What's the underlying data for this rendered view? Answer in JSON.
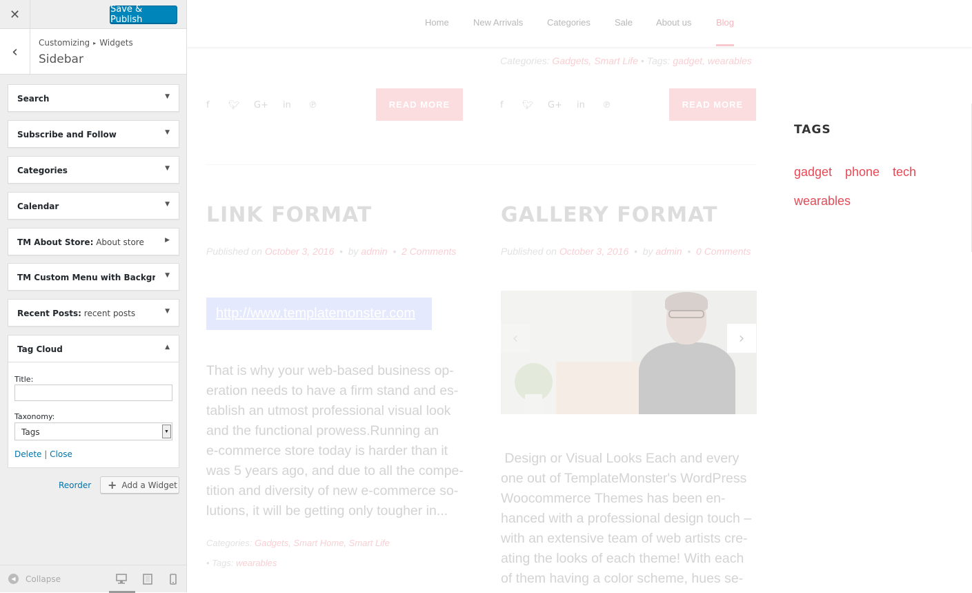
{
  "customizer": {
    "close_icon": "close-icon",
    "publish_label": "Save & Publish",
    "breadcrumb": [
      "Customizing",
      "Widgets"
    ],
    "section_title": "Sidebar",
    "widgets": [
      {
        "title": "Search",
        "subtitle": ""
      },
      {
        "title": "Subscribe and Follow",
        "subtitle": ""
      },
      {
        "title": "Categories",
        "subtitle": ""
      },
      {
        "title": "Calendar",
        "subtitle": ""
      },
      {
        "title": "TM About Store:",
        "subtitle": "About store"
      },
      {
        "title": "TM Custom Menu with Backgrou...",
        "subtitle": ""
      },
      {
        "title": "Recent Posts:",
        "subtitle": "recent posts"
      },
      {
        "title": "Tag Cloud",
        "subtitle": ""
      }
    ],
    "tag_cloud_form": {
      "title_label": "Title:",
      "title_value": "",
      "taxonomy_label": "Taxonomy:",
      "taxonomy_value": "Tags",
      "delete_label": "Delete",
      "separator": "|",
      "close_label": "Close"
    },
    "reorder_label": "Reorder",
    "add_widget_label": "Add a Widget",
    "collapse_label": "Collapse"
  },
  "preview": {
    "nav": [
      "Home",
      "New Arrivals",
      "Categories",
      "Sale",
      "About us",
      "Blog"
    ],
    "active_nav": "Blog",
    "top_meta": {
      "cat_label": "Categories:",
      "categories": "Gadgets, Smart Life",
      "tags_label": "Tags:",
      "tags": "gadget, wearables"
    },
    "read_more": "READ MORE",
    "posts": [
      {
        "title": "LINK FORMAT",
        "published_label": "Published on",
        "date": "October 3, 2016",
        "by_label": "by",
        "author": "admin",
        "comments": "2 Comments",
        "link": "http://www.templatemonster.com",
        "excerpt": "That is why your web-based business op-\neration needs to have a firm stand and es-\ntablish an utmost professional visual look\nand the functional prowess.Running an\ne-commerce store today is harder than it\nwas 5 years ago, and due to all the compe-\ntition and diversity of new e-commerce so-\nlutions, it will be getting only tougher in...",
        "cat_label": "Categories:",
        "categories": "Gadgets, Smart Home, Smart Life",
        "tags_label": "Tags:",
        "tags": "wearables"
      },
      {
        "title": "GALLERY FORMAT",
        "published_label": "Published on",
        "date": "October 3, 2016",
        "by_label": "by",
        "author": "admin",
        "comments": "0 Comments",
        "excerpt": " Design or Visual Looks Each and every\none out of TemplateMonster's WordPress\nWoocommerce Themes has been en-\nhanced with a professional design touch –\nwith an extensive team of web artists cre-\nating the looks of each theme! With each\nof them having a color scheme, hues se-"
      }
    ],
    "sidebar": {
      "title": "TAGS",
      "tags": [
        "gadget",
        "phone",
        "tech",
        "wearables"
      ]
    },
    "colors": {
      "accent": "#e34a56",
      "wp_blue": "#0085ba"
    }
  }
}
